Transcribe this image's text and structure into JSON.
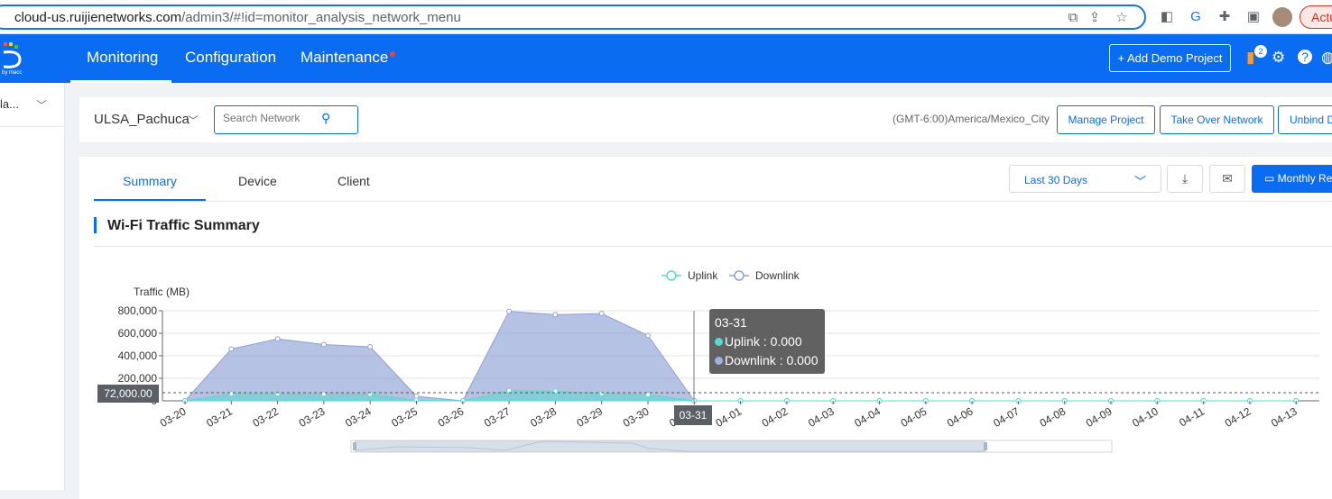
{
  "browser": {
    "url_host": "cloud-us.ruijienetworks.com",
    "url_path": "/admin3/#!id=monitor_analysis_network_menu",
    "profile_button": "Actu"
  },
  "topnav": {
    "items": [
      "Monitoring",
      "Configuration",
      "Maintenance"
    ],
    "add_demo": "+ Add Demo Project",
    "badge_count": "2",
    "brand_color": "#0a6cf1"
  },
  "sidebar": {
    "selector": "la..."
  },
  "toolbar": {
    "network_name": "ULSA_Pachuca",
    "search_placeholder": "Search Network",
    "timezone": "(GMT-6:00)America/Mexico_City",
    "buttons": [
      "Manage Project",
      "Take Over Network",
      "Unbind D"
    ]
  },
  "tabs": [
    "Summary",
    "Device",
    "Client"
  ],
  "range": {
    "selected": "Last 30 Days"
  },
  "monthly_button": "Monthly Re",
  "section_title": "Wi-Fi Traffic Summary",
  "chart_data": {
    "type": "area",
    "ylabel": "Traffic (MB)",
    "y_ticks": [
      "800,000",
      "600,000",
      "400,000",
      "200,000"
    ],
    "y_zero_tick": "0",
    "ylim": [
      0,
      800000
    ],
    "categories": [
      "03-20",
      "03-21",
      "03-22",
      "03-23",
      "03-24",
      "03-25",
      "03-26",
      "03-27",
      "03-28",
      "03-29",
      "03-30",
      "03-31",
      "04-01",
      "04-02",
      "04-03",
      "04-04",
      "04-05",
      "04-06",
      "04-07",
      "04-08",
      "04-09",
      "04-10",
      "04-11",
      "04-12",
      "04-13"
    ],
    "series": [
      {
        "name": "Uplink",
        "color": "#5ad8d0",
        "values": [
          0,
          62000,
          62000,
          60000,
          60000,
          5000,
          0,
          90000,
          85000,
          65000,
          55000,
          0,
          0,
          0,
          0,
          0,
          0,
          0,
          0,
          0,
          0,
          0,
          0,
          0,
          0
        ]
      },
      {
        "name": "Downlink",
        "color": "#8fa2d4",
        "values": [
          0,
          460000,
          550000,
          500000,
          480000,
          40000,
          0,
          795000,
          765000,
          775000,
          580000,
          0,
          0,
          0,
          0,
          0,
          0,
          0,
          0,
          0,
          0,
          0,
          0,
          0,
          0
        ]
      }
    ],
    "reference_line_label": "72,000.00",
    "reference_value": 72000,
    "tooltip": {
      "date": "03-31",
      "uplink": "Uplink : 0.000",
      "downlink": "Downlink : 0.000"
    },
    "hover_x_label": "03-31",
    "hover_index": 11,
    "legend": "top-center",
    "grid": true
  }
}
